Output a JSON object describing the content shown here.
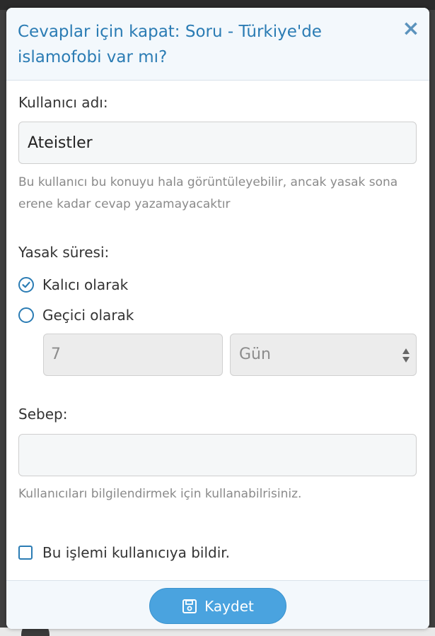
{
  "modal": {
    "title": "Cevaplar için kapat: Soru - Türkiye'de islamofobi var mı?",
    "close_glyph": "×"
  },
  "username": {
    "label": "Kullanıcı adı:",
    "value": "Ateistler",
    "help": "Bu kullanıcı bu konuyu hala görüntüleyebilir, ancak yasak sona erene kadar cevap yazamayacaktır"
  },
  "ban_duration": {
    "label": "Yasak süresi:",
    "options": [
      {
        "label": "Kalıcı olarak",
        "selected": true
      },
      {
        "label": "Geçici olarak",
        "selected": false
      }
    ],
    "amount_value": "7",
    "unit_value": "Gün"
  },
  "reason": {
    "label": "Sebep:",
    "value": "",
    "help": "Kullanıcıları bilgilendirmek için kullanabilrisiniz."
  },
  "notify": {
    "label": "Bu işlemi kullanıcıya bildir.",
    "checked": false
  },
  "footer": {
    "save_label": "Kaydet"
  },
  "colors": {
    "accent": "#2b7cb4",
    "button": "#4aa3df",
    "header_bg": "#f3f8fc"
  },
  "icons": {
    "close": "close-icon",
    "radio_checked": "check-circle-icon",
    "radio_unchecked": "circle-icon",
    "select_arrows": "sort-arrows-icon",
    "checkbox": "checkbox-icon",
    "save": "floppy-disk-icon"
  }
}
